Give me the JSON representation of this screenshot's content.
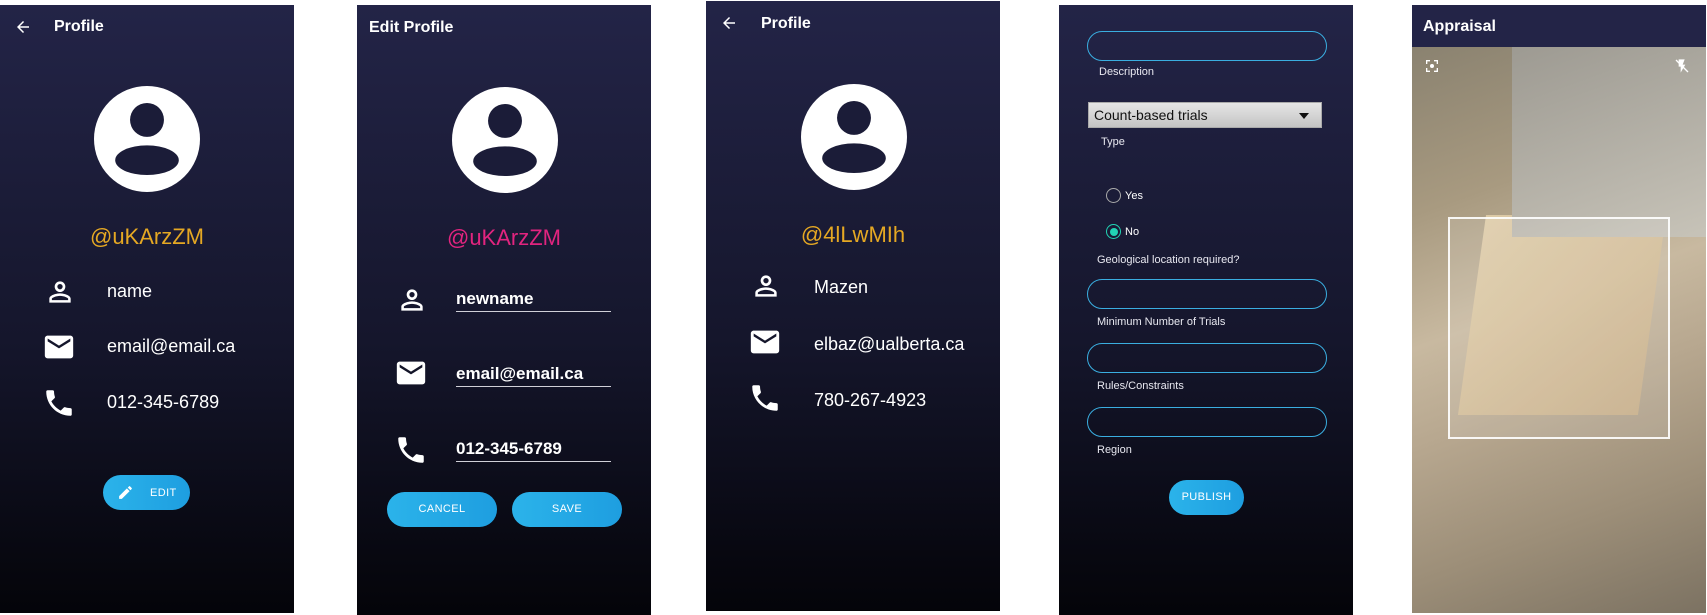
{
  "colors": {
    "handle_gold": "#e5a823",
    "handle_magenta": "#e2247f",
    "accent_blue": "#1fa3e4",
    "radio_teal": "#22d3b4"
  },
  "screen1": {
    "title": "Profile",
    "handle": "@uKArzZM",
    "name": "name",
    "email": "email@email.ca",
    "phone": "012-345-6789",
    "edit_label": "EDIT",
    "icons": [
      "back-arrow-icon",
      "avatar-icon",
      "person-icon",
      "mail-icon",
      "phone-icon",
      "pencil-icon"
    ]
  },
  "screen2": {
    "title": "Edit Profile",
    "handle": "@uKArzZM",
    "name_value": "newname",
    "email_value": "email@email.ca",
    "phone_value": "012-345-6789",
    "cancel_label": "CANCEL",
    "save_label": "SAVE"
  },
  "screen3": {
    "title": "Profile",
    "handle": "@4lLwMIh",
    "name": "Mazen",
    "email": "elbaz@ualberta.ca",
    "phone": "780-267-4923"
  },
  "screen4": {
    "description_label": "Description",
    "type_selected": "Count-based trials",
    "type_label": "Type",
    "radio_yes": "Yes",
    "radio_no": "No",
    "radio_selected": "No",
    "geo_label": "Geological location required?",
    "min_trials_label": "Minimum Number of Trials",
    "rules_label": "Rules/Constraints",
    "region_label": "Region",
    "publish_label": "PUBLISH"
  },
  "screen5": {
    "title": "Appraisal",
    "icons": [
      "scan-focus-icon",
      "flash-off-icon"
    ]
  }
}
